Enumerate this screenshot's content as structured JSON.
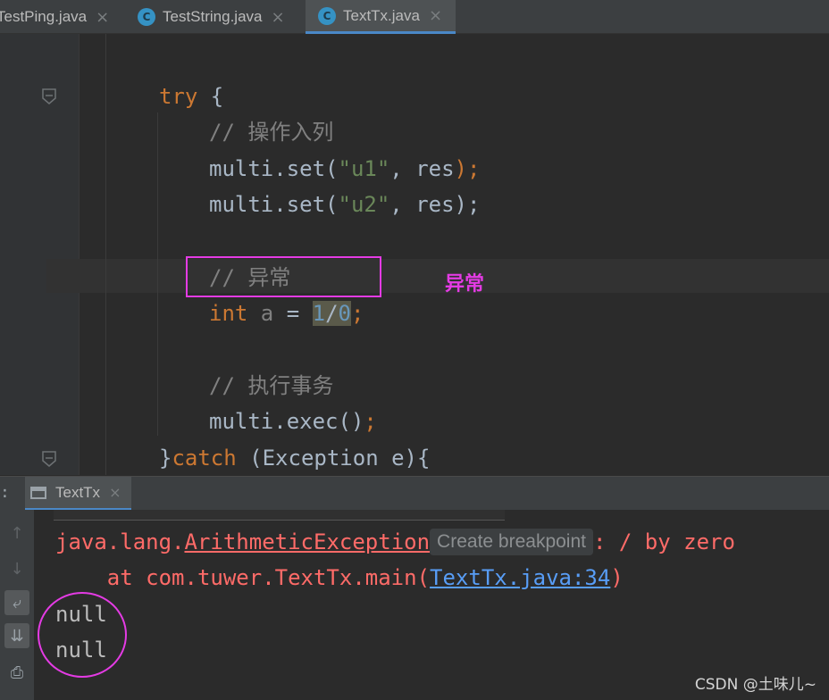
{
  "tabs": [
    {
      "label": "TestPing.java",
      "active": false,
      "icon": "class-icon"
    },
    {
      "label": "TestString.java",
      "active": false,
      "icon": "class-icon"
    },
    {
      "label": "TextTx.java",
      "active": true,
      "icon": "class-icon"
    }
  ],
  "tab_close_glyph": "×",
  "class_icon_glyph": "C",
  "code": {
    "try_kw": "try",
    "try_brace": " {",
    "comment1": "// 操作入列",
    "set1_pre": "multi.set(",
    "set1_str": "\"u1\"",
    "set1_post": ", res",
    "set1_semi": ");",
    "set2_pre": "multi.set(",
    "set2_str": "\"u2\"",
    "set2_post": ", res",
    "set2_semi": ");",
    "comment2": "// 异常",
    "int_kw": "int",
    "int_var": " a",
    "int_eq": " = ",
    "int_num1": "1",
    "int_slash": "/",
    "int_num2": "0",
    "int_semi": ";",
    "comment3": "// 执行事务",
    "exec": "multi.exec()",
    "exec_semi": ";",
    "catch_brace": "}",
    "catch_kw": "catch",
    "catch_rest": " (Exception e){"
  },
  "annotation": "异常",
  "run": {
    "tab_label": "TextTx",
    "colon": ":",
    "tools": [
      "arrow-up-icon",
      "arrow-down-icon",
      "soft-wrap-icon",
      "scroll-to-end-icon",
      "print-icon"
    ],
    "tool_glyphs": [
      "↑",
      "↓",
      "⤶",
      "⇊",
      "⎙"
    ]
  },
  "console": {
    "exc_pkg": "java.lang.",
    "exc_class": "ArithmeticException",
    "tooltip": "Create breakpoint",
    "exc_msg": ": / by zero",
    "at_prefix": "    at com.tuwer.TextTx.main(",
    "at_link": "TextTx.java:34",
    "at_suffix": ")",
    "null1": "null",
    "null2": "null"
  },
  "colors": {
    "keyword": "#cc7832",
    "string": "#6a8759",
    "comment": "#808080",
    "number": "#6897bb",
    "error": "#ff6b68",
    "link": "#589df6",
    "annotation": "#e43be4"
  },
  "watermark": "CSDN @土味儿~"
}
